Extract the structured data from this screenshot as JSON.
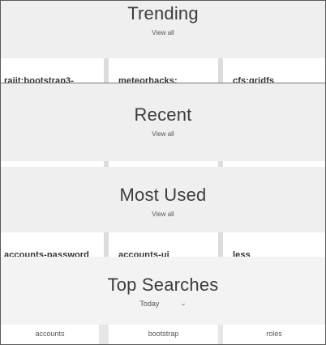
{
  "sections": {
    "trending": {
      "title": "Trending",
      "view_all": "View all",
      "packages": [
        "rajit:bootstrap3-",
        "meteorhacks:",
        "cfs:gridfs"
      ]
    },
    "recent": {
      "title": "Recent",
      "view_all": "View all"
    },
    "most_used": {
      "title": "Most Used",
      "view_all": "View all",
      "packages": [
        "accounts-password",
        "accounts-ui",
        "less"
      ]
    },
    "top_searches": {
      "title": "Top Searches",
      "period_selected": "Today",
      "terms": [
        "accounts",
        "bootstrap",
        "roles"
      ]
    }
  },
  "colors": {
    "band_bg": "#efefef",
    "card_bg": "#ffffff",
    "gap_bg": "#dcdcdc",
    "title_text": "#3d3d3d"
  }
}
